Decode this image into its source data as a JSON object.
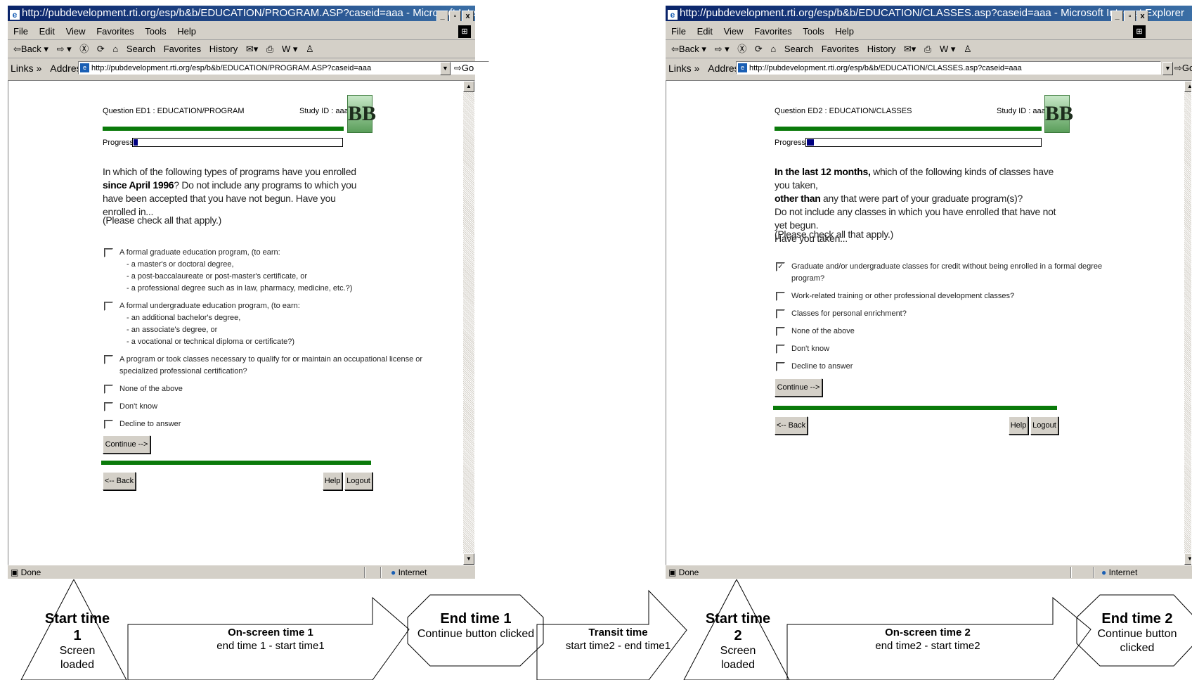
{
  "window1": {
    "title": "http://pubdevelopment.rti.org/esp/b&b/EDUCATION/PROGRAM.ASP?caseid=aaa - Microsoft Internet Explorer",
    "address_label": "Address",
    "links_label": "Links »",
    "url": "http://pubdevelopment.rti.org/esp/b&b/EDUCATION/PROGRAM.ASP?caseid=aaa",
    "status": "Done",
    "zone": "Internet",
    "question_header": "Question ED1 : EDUCATION/PROGRAM",
    "study_id": "Study ID : aaa",
    "progress_label": "Progress:",
    "progress_fraction": 0.02,
    "question_pre": "In which of the following types of programs have you enrolled ",
    "question_bold": "since April 1996",
    "question_post": "? Do not include any programs to which you have been accepted that you have not begun. Have you enrolled in...",
    "instruction": "(Please check all that apply.)",
    "options": [
      {
        "lines": [
          "A formal graduate education program, (to earn:",
          "- a master's or doctoral degree,",
          "- a post-baccalaureate or post-master's certificate, or",
          "- a professional degree such as in law, pharmacy, medicine, etc.?)"
        ],
        "checked": false
      },
      {
        "lines": [
          "A formal undergraduate education program, (to earn:",
          "- an additional bachelor's degree,",
          "- an associate's degree, or",
          "- a vocational or technical diploma or certificate?)"
        ],
        "checked": false
      },
      {
        "lines": [
          "A program or took classes necessary to qualify for or maintain an occupational license or",
          "specialized professional certification?"
        ],
        "checked": false
      },
      {
        "lines": [
          "None of the above"
        ],
        "checked": false
      },
      {
        "lines": [
          "Don't know"
        ],
        "checked": false
      },
      {
        "lines": [
          "Decline to answer"
        ],
        "checked": false
      }
    ],
    "continue_label": "Continue -->",
    "back_label": "<-- Back",
    "help_label": "Help",
    "logout_label": "Logout"
  },
  "window2": {
    "title": "http://pubdevelopment.rti.org/esp/b&b/EDUCATION/CLASSES.asp?caseid=aaa - Microsoft Internet Explorer",
    "address_label": "Address",
    "links_label": "Links »",
    "url": "http://pubdevelopment.rti.org/esp/b&b/EDUCATION/CLASSES.asp?caseid=aaa",
    "status": "Done",
    "zone": "Internet",
    "question_header": "Question ED2 : EDUCATION/CLASSES",
    "study_id": "Study ID : aaa",
    "progress_label": "Progress:",
    "progress_fraction": 0.03,
    "question_bold1": "In the last 12 months,",
    "question_mid1": " which of the following kinds of classes have you taken,",
    "question_bold2": "other than",
    "question_mid2": " any that were part of your graduate program(s)?",
    "question_line3": "Do not include any classes in which you have enrolled that have not yet begun.",
    "question_line4": "Have you taken...",
    "instruction": "(Please check all that apply.)",
    "options": [
      {
        "lines": [
          "Graduate and/or undergraduate classes for credit without being enrolled in a formal degree",
          "program?"
        ],
        "checked": true
      },
      {
        "lines": [
          "Work-related training or other professional development classes?"
        ],
        "checked": false
      },
      {
        "lines": [
          "Classes for personal enrichment?"
        ],
        "checked": false
      },
      {
        "lines": [
          "None of the above"
        ],
        "checked": false
      },
      {
        "lines": [
          "Don't know"
        ],
        "checked": false
      },
      {
        "lines": [
          "Decline to answer"
        ],
        "checked": false
      }
    ],
    "continue_label": "Continue -->",
    "back_label": "<-- Back",
    "help_label": "Help",
    "logout_label": "Logout"
  },
  "browser": {
    "menu": [
      "File",
      "Edit",
      "View",
      "Favorites",
      "Tools",
      "Help"
    ],
    "toolbar": [
      "⇦Back ▾",
      "⇨ ▾",
      "Ⓧ",
      "⟳",
      "⌂",
      "Search",
      "Favorites",
      "History",
      "✉▾",
      "⎙",
      "W ▾",
      "♙"
    ],
    "go_label": "Go"
  },
  "diagram": {
    "start1_title": "Start time 1",
    "start1_sub": "Screen loaded",
    "onscreen1_title": "On-screen time 1",
    "onscreen1_sub": "end time 1 - start time1",
    "end1_title": "End time 1",
    "end1_sub": "Continue button clicked",
    "transit_title": "Transit time",
    "transit_sub": "start time2 - end time1",
    "start2_title": "Start time 2",
    "start2_sub": "Screen loaded",
    "onscreen2_title": "On-screen time 2",
    "onscreen2_sub": "end time2 - start time2",
    "end2_title": "End time 2",
    "end2_sub": "Continue button clicked"
  }
}
